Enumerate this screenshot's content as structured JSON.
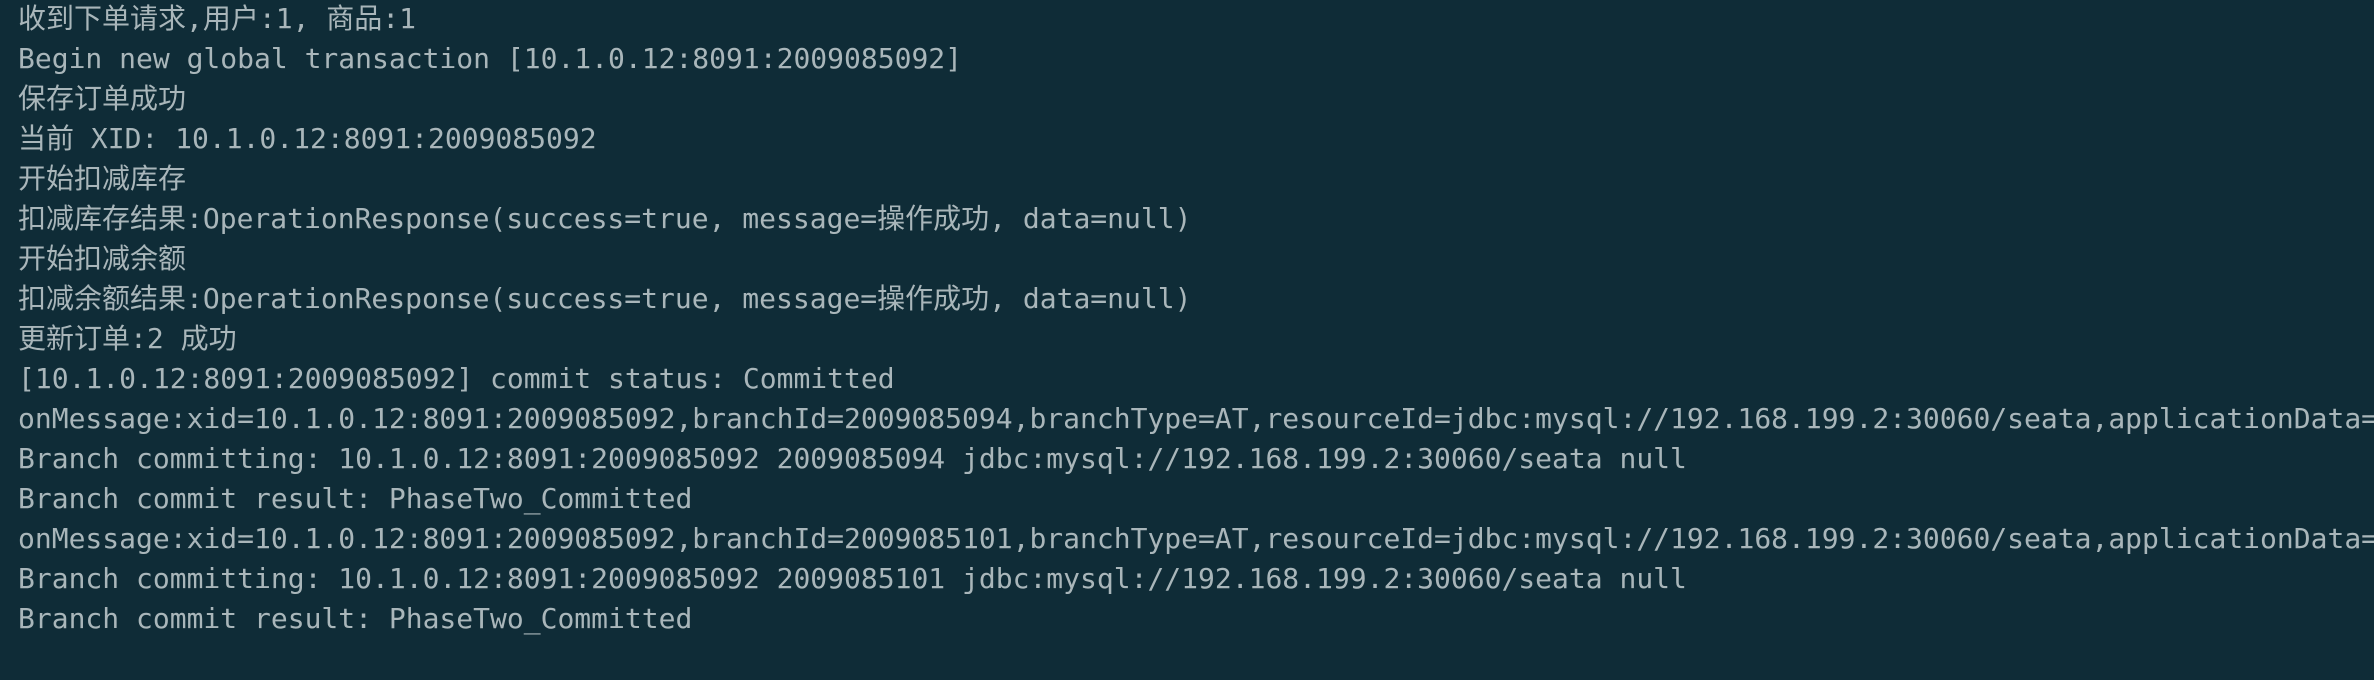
{
  "terminal": {
    "lines": [
      "收到下单请求,用户:1, 商品:1",
      "Begin new global transaction [10.1.0.12:8091:2009085092]",
      "保存订单成功",
      "当前 XID: 10.1.0.12:8091:2009085092",
      "开始扣减库存",
      "扣减库存结果:OperationResponse(success=true, message=操作成功, data=null)",
      "开始扣减余额",
      "扣减余额结果:OperationResponse(success=true, message=操作成功, data=null)",
      "更新订单:2 成功",
      "[10.1.0.12:8091:2009085092] commit status: Committed",
      "onMessage:xid=10.1.0.12:8091:2009085092,branchId=2009085094,branchType=AT,resourceId=jdbc:mysql://192.168.199.2:30060/seata,applicationData=null",
      "Branch committing: 10.1.0.12:8091:2009085092 2009085094 jdbc:mysql://192.168.199.2:30060/seata null",
      "Branch commit result: PhaseTwo_Committed",
      "onMessage:xid=10.1.0.12:8091:2009085092,branchId=2009085101,branchType=AT,resourceId=jdbc:mysql://192.168.199.2:30060/seata,applicationData=null",
      "Branch committing: 10.1.0.12:8091:2009085092 2009085101 jdbc:mysql://192.168.199.2:30060/seata null",
      "Branch commit result: PhaseTwo_Committed"
    ],
    "colors": {
      "background": "#0f2c37",
      "text": "#a9b6ba"
    }
  }
}
